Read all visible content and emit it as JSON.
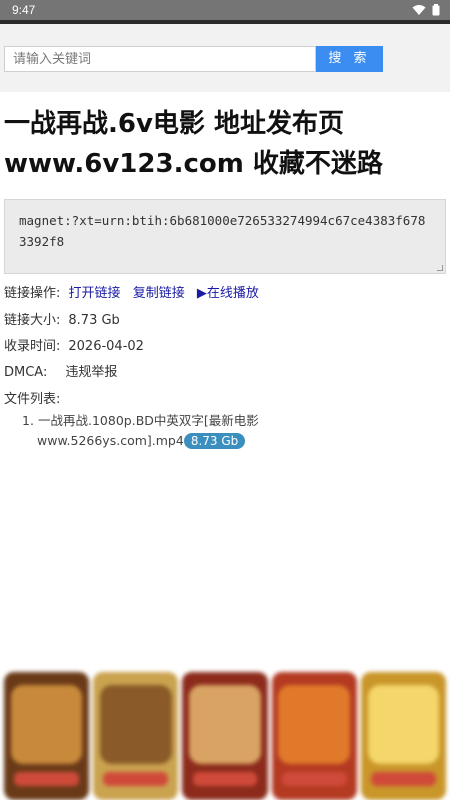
{
  "status_bar": {
    "time": "9:47"
  },
  "search": {
    "placeholder": "请输入关键词",
    "button_label": "搜 索"
  },
  "title": {
    "line1": "一战再战.6v电影 地址发布页",
    "line2": "www.6v123.com 收藏不迷路"
  },
  "magnet": {
    "text": "magnet:?xt=urn:btih:6b681000e726533274994c67ce4383f6783392f8"
  },
  "actions": {
    "label": "链接操作:",
    "open_link": "打开链接",
    "copy_link": "复制链接",
    "play_online": "▶在线播放"
  },
  "size": {
    "label": "链接大小:",
    "value": "8.73 Gb"
  },
  "time": {
    "label": "收录时间:",
    "value": "2026-04-02"
  },
  "dmca": {
    "label": "DMCA:",
    "value": "违规举报"
  },
  "files": {
    "label": "文件列表:",
    "items": [
      {
        "index": "1.",
        "name_line1": "一战再战.1080p.BD中英双字[最新电影",
        "name_line2": "www.5266ys.com].mp4",
        "size": "8.73 Gb"
      }
    ]
  },
  "ads": {
    "count": 5
  }
}
